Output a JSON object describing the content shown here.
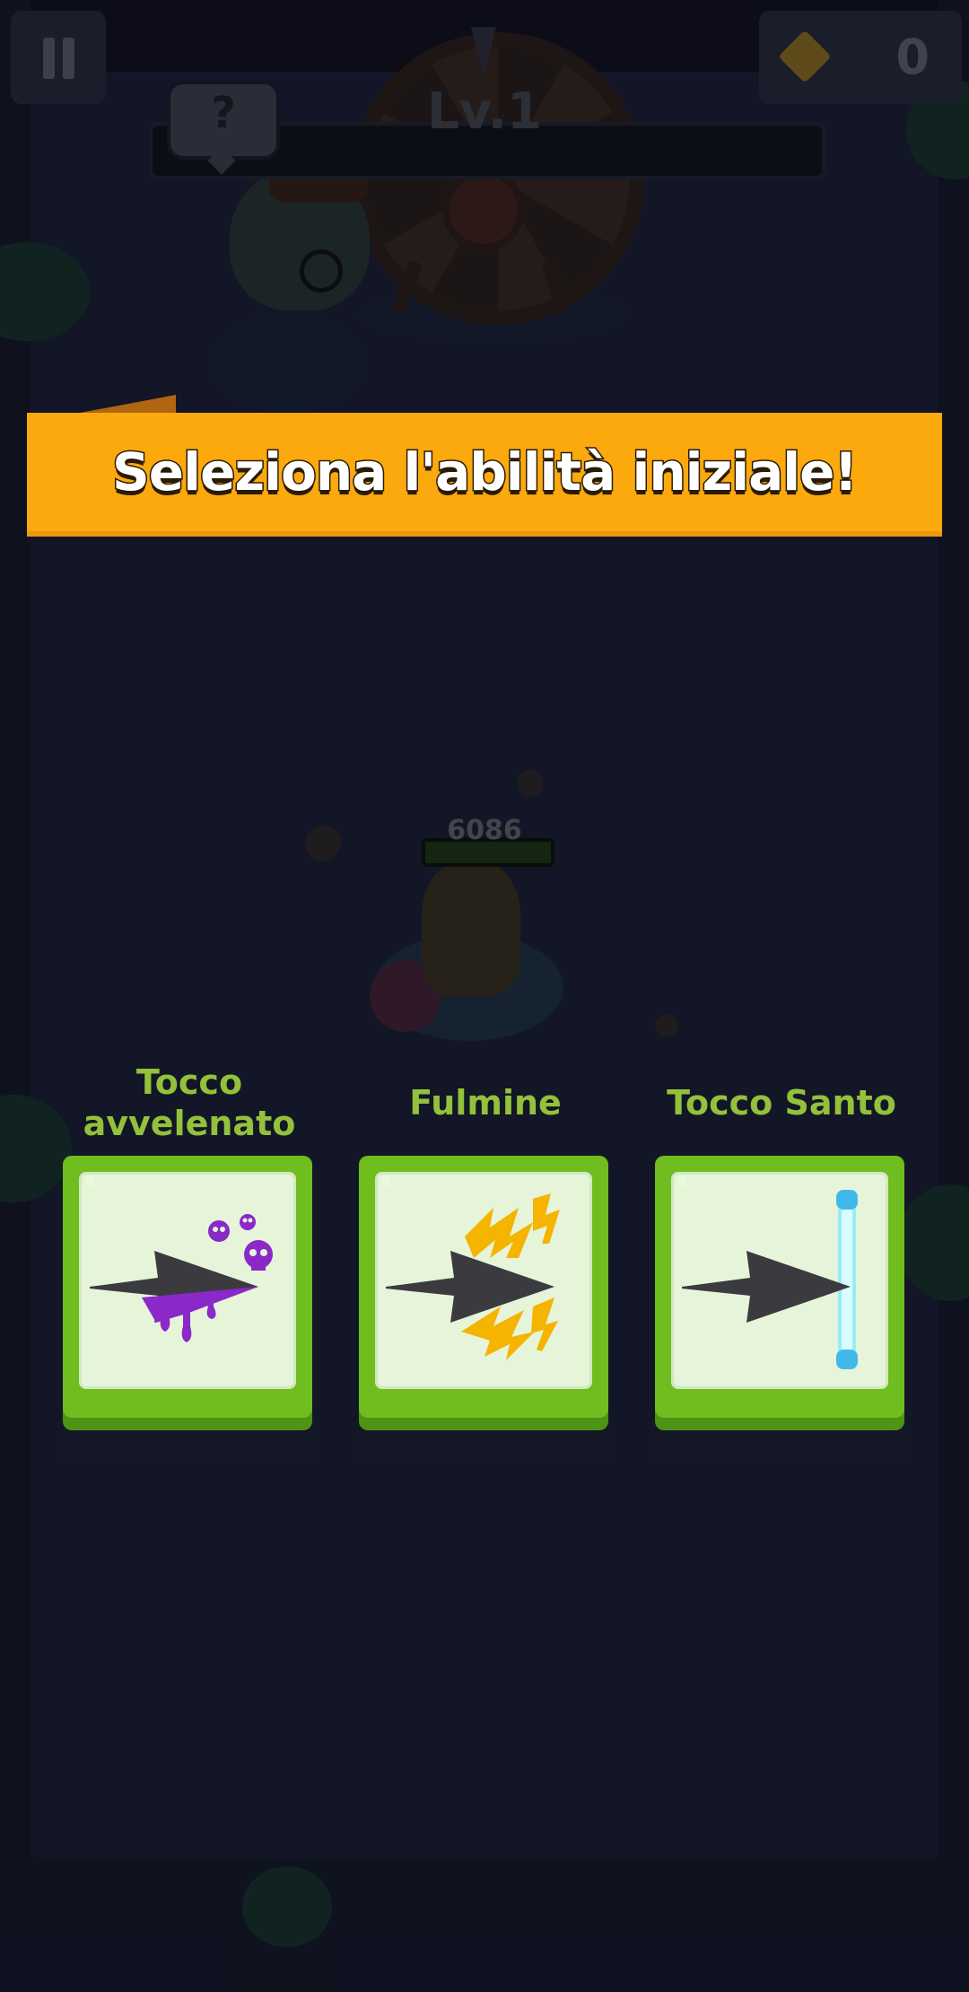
{
  "hud": {
    "level_label": "Lv.1",
    "gem_count": "0",
    "help_label": "?",
    "pause_icon": "pause-icon",
    "gem_icon": "gem-icon"
  },
  "hero": {
    "hp": "6086"
  },
  "banner": {
    "title": "Seleziona l'abilità iniziale!",
    "color": "#fca90e"
  },
  "skills": [
    {
      "name": "Tocco avvelenato",
      "icon": "poison-arrow-icon"
    },
    {
      "name": "Fulmine",
      "icon": "lightning-arrow-icon"
    },
    {
      "name": "Tocco Santo",
      "icon": "holy-arrow-icon"
    }
  ],
  "colors": {
    "skill_label": "#93c13c",
    "card_green": "#6fbd1e",
    "card_inner": "#e6f4da"
  }
}
